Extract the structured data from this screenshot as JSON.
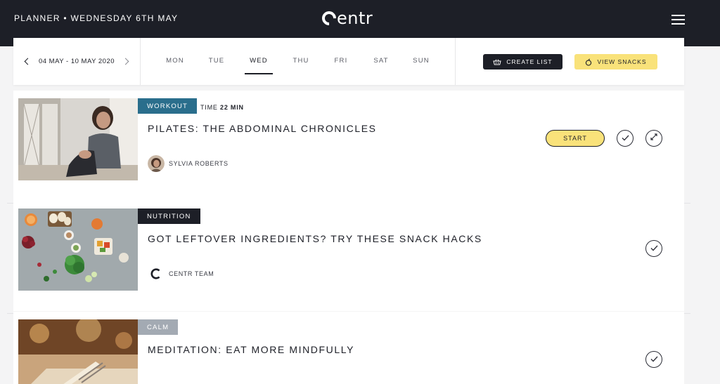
{
  "header": {
    "breadcrumb": "PLANNER • WEDNESDAY 6TH MAY",
    "logo_text": "entr",
    "menu_icon": "hamburger-icon"
  },
  "week_nav": {
    "date_range": "04 MAY - 10 MAY 2020",
    "days": [
      {
        "label": "MON",
        "active": false
      },
      {
        "label": "TUE",
        "active": false
      },
      {
        "label": "WED",
        "active": true
      },
      {
        "label": "THU",
        "active": false
      },
      {
        "label": "FRI",
        "active": false
      },
      {
        "label": "SAT",
        "active": false
      },
      {
        "label": "SUN",
        "active": false
      }
    ],
    "create_list_label": "CREATE LIST",
    "view_snacks_label": "VIEW SNACKS"
  },
  "cards": [
    {
      "tag": "WORKOUT",
      "tag_color": "#2a6e8c",
      "time_label": "TIME",
      "time_value": "22 MIN",
      "title": "PILATES: THE ABDOMINAL CHRONICLES",
      "author": "SYLVIA ROBERTS",
      "start_label": "START"
    },
    {
      "tag": "NUTRITION",
      "tag_color": "#1d1f27",
      "title": "GOT LEFTOVER INGREDIENTS? TRY THESE SNACK HACKS",
      "author": "CENTR TEAM"
    },
    {
      "tag": "CALM",
      "tag_color": "#a3aab3",
      "title": "MEDITATION: EAT MORE MINDFULLY"
    }
  ],
  "colors": {
    "dark": "#1d1f27",
    "accent_yellow": "#f9e27a"
  }
}
